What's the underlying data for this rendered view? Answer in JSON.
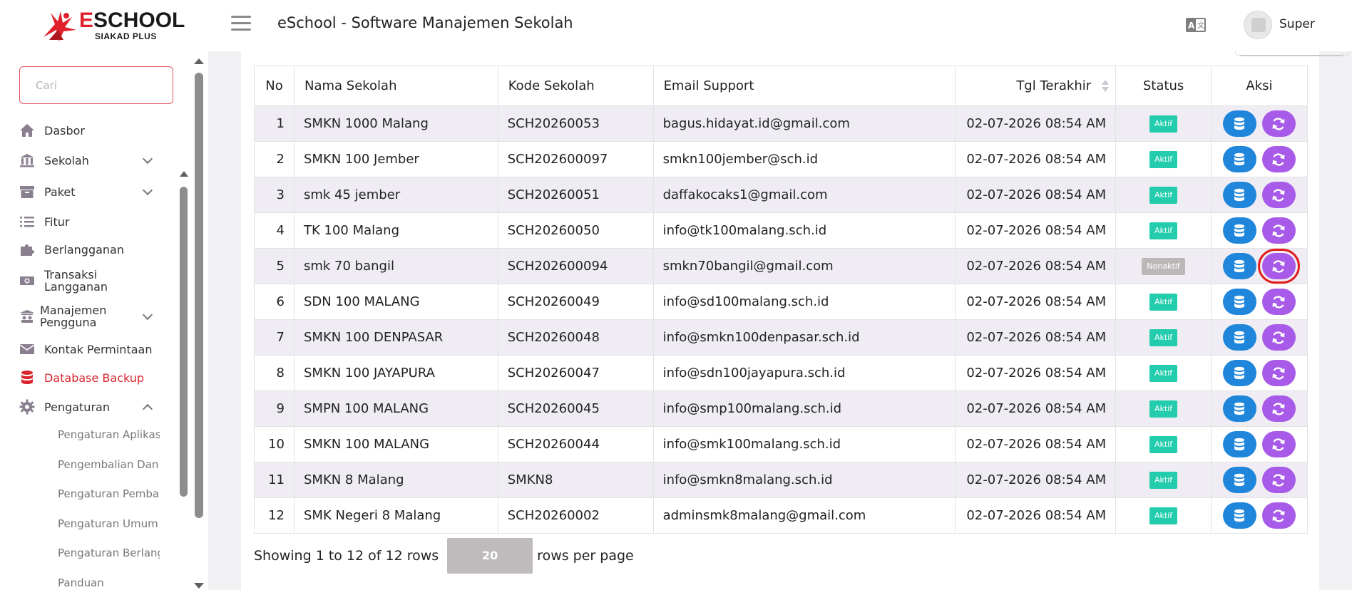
{
  "header": {
    "logo_brand": "ESCHOOL",
    "logo_brand_first": "E",
    "logo_brand_rest": "SCHOOL",
    "logo_sub": "SIAKAD PLUS",
    "app_title": "eSchool - Software Manajemen Sekolah",
    "user_name": "Super",
    "icons": [
      "menu-icon",
      "language-icon",
      "avatar"
    ]
  },
  "sidebar": {
    "search_placeholder": "Cari",
    "items": [
      {
        "label": "Dasbor",
        "icon": "home-icon"
      },
      {
        "label": "Sekolah",
        "icon": "bank-icon",
        "expandable": true
      },
      {
        "label": "Paket",
        "icon": "archive-icon",
        "expandable": true
      },
      {
        "label": "Fitur",
        "icon": "list-icon"
      },
      {
        "label": "Berlangganan",
        "icon": "puzzle-icon"
      },
      {
        "label": "Transaksi Langganan",
        "icon": "money-icon"
      },
      {
        "label": "Manajemen Pengguna",
        "icon": "users-icon",
        "expandable": true
      },
      {
        "label": "Kontak Permintaan",
        "icon": "envelope-icon"
      },
      {
        "label": "Database Backup",
        "icon": "database-icon",
        "active": true
      },
      {
        "label": "Pengaturan",
        "icon": "gear-icon",
        "expandable": true,
        "expanded": true
      }
    ],
    "sub_items": [
      "Pengaturan Aplikas",
      "Pengembalian Dan",
      "Pengaturan Pemba",
      "Pengaturan Umum",
      "Pengaturan Berlang",
      "Panduan"
    ]
  },
  "table": {
    "columns": [
      "No",
      "Nama Sekolah",
      "Kode Sekolah",
      "Email Support",
      "Tgl Terakhir",
      "Status",
      "Aksi"
    ],
    "rows": [
      {
        "no": "1",
        "name": "SMKN 1000 Malang",
        "code": "SCH20260053",
        "email": "bagus.hidayat.id@gmail.com",
        "date": "02-07-2026 08:54 AM",
        "status": "Aktif"
      },
      {
        "no": "2",
        "name": "SMKN 100 Jember",
        "code": "SCH202600097",
        "email": "smkn100jember@sch.id",
        "date": "02-07-2026 08:54 AM",
        "status": "Aktif"
      },
      {
        "no": "3",
        "name": "smk 45 jember",
        "code": "SCH20260051",
        "email": "daffakocaks1@gmail.com",
        "date": "02-07-2026 08:54 AM",
        "status": "Aktif"
      },
      {
        "no": "4",
        "name": "TK 100 Malang",
        "code": "SCH20260050",
        "email": "info@tk100malang.sch.id",
        "date": "02-07-2026 08:54 AM",
        "status": "Aktif"
      },
      {
        "no": "5",
        "name": "smk 70 bangil",
        "code": "SCH202600094",
        "email": "smkn70bangil@gmail.com",
        "date": "02-07-2026 08:54 AM",
        "status": "Nonaktif",
        "highlight_sync": true
      },
      {
        "no": "6",
        "name": "SDN 100 MALANG",
        "code": "SCH20260049",
        "email": "info@sd100malang.sch.id",
        "date": "02-07-2026 08:54 AM",
        "status": "Aktif"
      },
      {
        "no": "7",
        "name": "SMKN 100 DENPASAR",
        "code": "SCH20260048",
        "email": "info@smkn100denpasar.sch.id",
        "date": "02-07-2026 08:54 AM",
        "status": "Aktif"
      },
      {
        "no": "8",
        "name": "SMKN 100 JAYAPURA",
        "code": "SCH20260047",
        "email": "info@sdn100jayapura.sch.id",
        "date": "02-07-2026 08:54 AM",
        "status": "Aktif"
      },
      {
        "no": "9",
        "name": "SMPN 100 MALANG",
        "code": "SCH20260045",
        "email": "info@smp100malang.sch.id",
        "date": "02-07-2026 08:54 AM",
        "status": "Aktif"
      },
      {
        "no": "10",
        "name": "SMKN 100 MALANG",
        "code": "SCH20260044",
        "email": "info@smk100malang.sch.id",
        "date": "02-07-2026 08:54 AM",
        "status": "Aktif"
      },
      {
        "no": "11",
        "name": "SMKN 8 Malang",
        "code": "SMKN8",
        "email": "info@smkn8malang.sch.id",
        "date": "02-07-2026 08:54 AM",
        "status": "Aktif"
      },
      {
        "no": "12",
        "name": "SMK Negeri 8 Malang",
        "code": "SCH20260002",
        "email": "adminsmk8malang@gmail.com",
        "date": "02-07-2026 08:54 AM",
        "status": "Aktif"
      }
    ],
    "action_icons": [
      "database-icon",
      "sync-icon"
    ]
  },
  "pagination": {
    "showing_text": "Showing 1 to 12 of 12 rows",
    "per_page_value": "20",
    "per_page_label": "rows per page"
  },
  "colors": {
    "brand_red": "#e0202a",
    "active_nav": "#d8252e",
    "badge_aktif": "#22ccad",
    "badge_nonaktif": "#bdb8b8",
    "btn_database": "#1f86db",
    "btn_sync": "#a85ae8",
    "highlight": "#e21b1b"
  }
}
